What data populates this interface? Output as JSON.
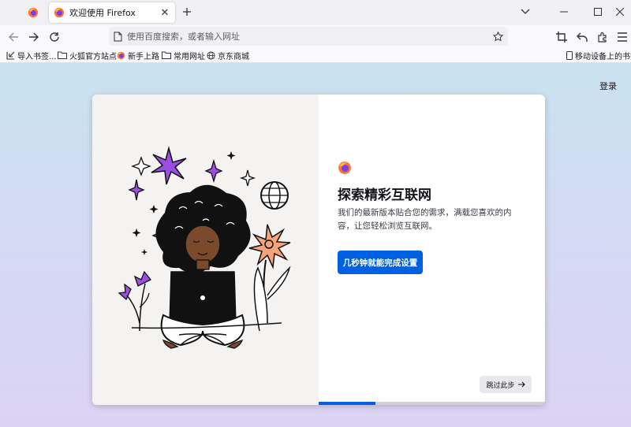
{
  "tabs": [
    {
      "title": "",
      "pinned": true,
      "icon": "firefox-icon"
    },
    {
      "title": "欢迎使用 Firefox",
      "active": true,
      "icon": "firefox-icon"
    }
  ],
  "navbar": {
    "url_placeholder": "使用百度搜索，或者输入网址"
  },
  "bookmarks": {
    "items": [
      {
        "label": "导入书签...",
        "icon": "import-icon"
      },
      {
        "label": "火狐官方站点",
        "icon": "folder-icon"
      },
      {
        "label": "新手上路",
        "icon": "firefox-icon"
      },
      {
        "label": "常用网址",
        "icon": "folder-icon"
      },
      {
        "label": "京东商城",
        "icon": "globe-icon"
      }
    ],
    "mobile_label": "移动设备上的书签"
  },
  "page": {
    "login": "登录",
    "headline": "探索精彩互联网",
    "subtitle": "我们的最新版本贴合您的需求，满载您喜欢的内容，让您轻松浏览互联网。",
    "primary_button": "几秒钟就能完成设置",
    "skip_button": "跳过此步",
    "progress": 0.25
  },
  "colors": {
    "accent": "#0061e0",
    "bg_top": "#c9e2f0",
    "bg_bottom": "#dcd3f3"
  }
}
